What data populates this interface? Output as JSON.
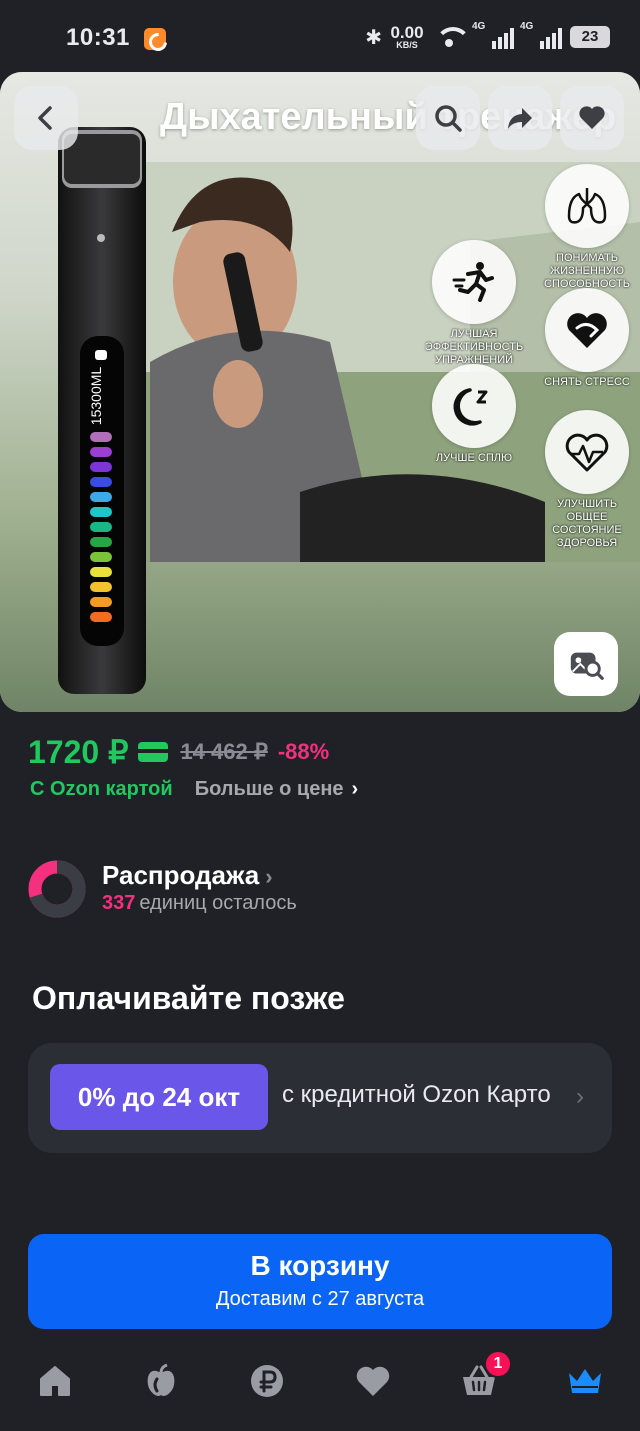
{
  "status_bar": {
    "time": "10:31",
    "net_speed_value": "0.00",
    "net_speed_unit": "KB/S",
    "network_1": "4G",
    "network_2": "4G",
    "battery": "23"
  },
  "product": {
    "title": "Дыхательный тренажер",
    "device_label": "15300ML",
    "features": [
      {
        "icon": "running-man-icon",
        "caption": "Лучшая эффективность упражнений"
      },
      {
        "icon": "moon-icon",
        "caption": "Лучше сплю"
      },
      {
        "icon": "lungs-icon",
        "caption": "Понимать жизненную способность"
      },
      {
        "icon": "heart-stress-icon",
        "caption": "Снять стресс"
      },
      {
        "icon": "heart-pulse-icon",
        "caption": "Улучшить общее состояние здоровья"
      }
    ]
  },
  "price": {
    "current": "1720 ₽",
    "old": "14 462 ₽",
    "discount": "-88%",
    "with_card": "С Ozon картой",
    "more": "Больше о цене"
  },
  "sale": {
    "title": "Распродажа",
    "count": "337",
    "remaining": "единиц осталось",
    "progress_fraction": 0.3
  },
  "pay_later": {
    "heading": "Оплачивайте позже",
    "badge": "0% до 24 окт",
    "text": "с кредитной Ozon Карто"
  },
  "cart": {
    "label": "В корзину",
    "delivery": "Доставим с 27 августа"
  },
  "tabbar": {
    "cart_badge": "1"
  },
  "colors": {
    "background": "#1f2127",
    "price_green": "#21c85f",
    "discount_pink": "#f5307f",
    "credit_purple": "#6a56e8",
    "cart_blue": "#0a65f6"
  }
}
